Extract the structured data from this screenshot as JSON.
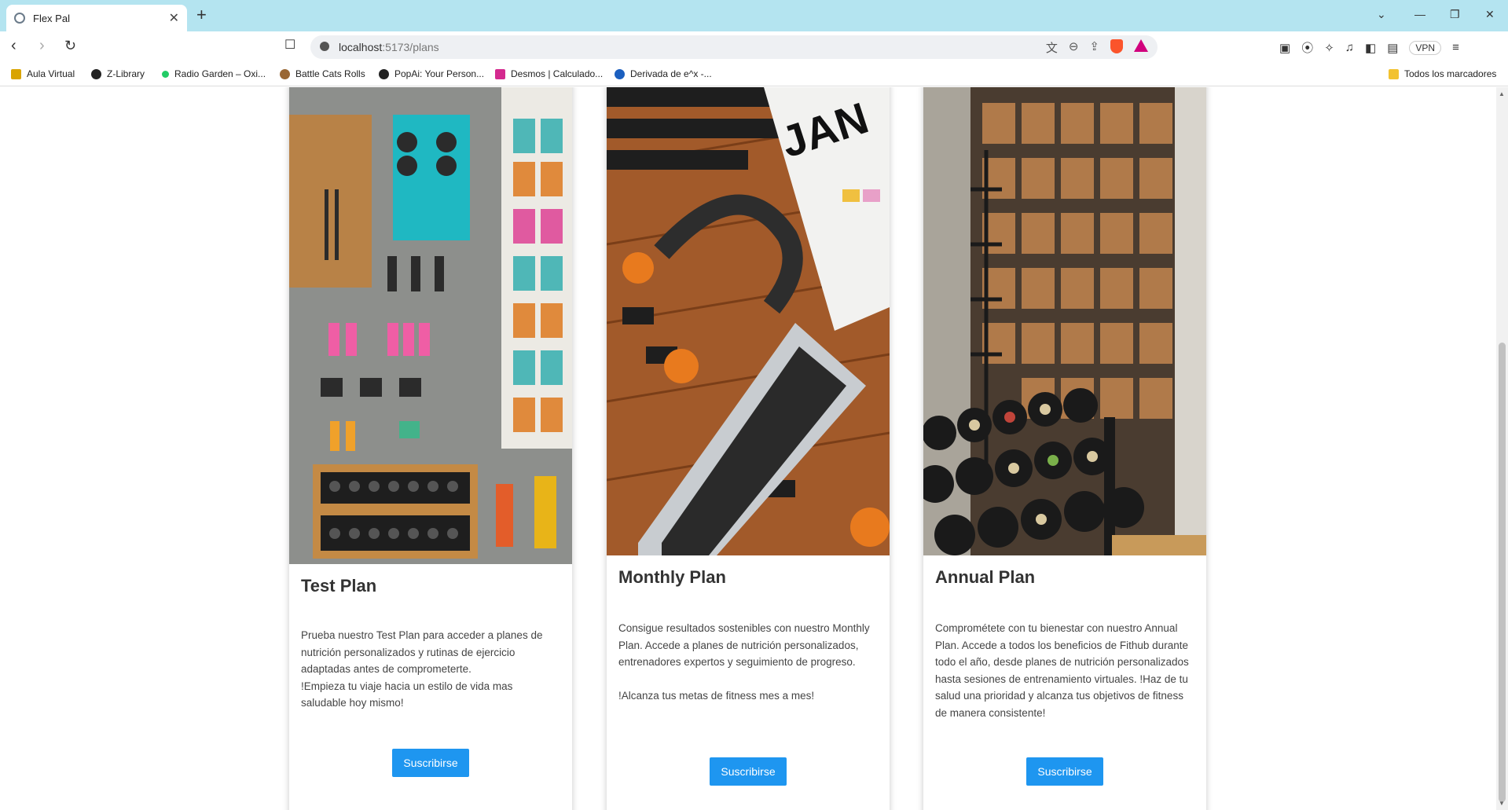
{
  "browser": {
    "tab_title": "Flex Pal",
    "url_host": "localhost",
    "url_path": ":5173/plans",
    "vpn_label": "VPN",
    "bookmarks": [
      {
        "label": "Aula Virtual",
        "icon": "bar-chart-icon",
        "color": "#d9a400"
      },
      {
        "label": "Z-Library",
        "icon": "z-logo-icon",
        "color": "#222222"
      },
      {
        "label": "Radio Garden – Oxi...",
        "icon": "dot-icon",
        "color": "#22cc66"
      },
      {
        "label": "Battle Cats Rolls",
        "icon": "cat-icon",
        "color": "#996633"
      },
      {
        "label": "PopAi: Your Person...",
        "icon": "popai-icon",
        "color": "#222222"
      },
      {
        "label": "Desmos | Calculado...",
        "icon": "desmos-icon",
        "color": "#d42a8f"
      },
      {
        "label": "Derivada de e^x -...",
        "icon": "derivative-icon",
        "color": "#1b5fbf"
      }
    ],
    "all_bookmarks_label": "Todos los marcadores"
  },
  "plans": [
    {
      "title": "Test Plan",
      "description": "Prueba nuestro Test Plan para acceder a planes de nutrición personalizados y rutinas de ejercicio adaptadas antes de comprometerte.\n!Empieza tu viaje hacia un estilo de vida mas saludable hoy mismo!",
      "button": "Suscribirse"
    },
    {
      "title": "Monthly Plan",
      "description": "Consigue resultados sostenibles con nuestro Monthly Plan. Accede a planes de nutrición personalizados, entrenadores expertos y seguimiento de progreso.\n\n!Alcanza tus metas de fitness mes a mes!",
      "button": "Suscribirse"
    },
    {
      "title": "Annual Plan",
      "description": "Comprométete con tu bienestar con nuestro Annual Plan. Accede a todos los beneficios de Fithub durante todo el año, desde planes de nutrición personalizados hasta sesiones de entrenamiento virtuales. !Haz de tu salud una prioridad y alcanza tus objetivos de fitness de manera consistente!",
      "button": "Suscribirse"
    }
  ]
}
